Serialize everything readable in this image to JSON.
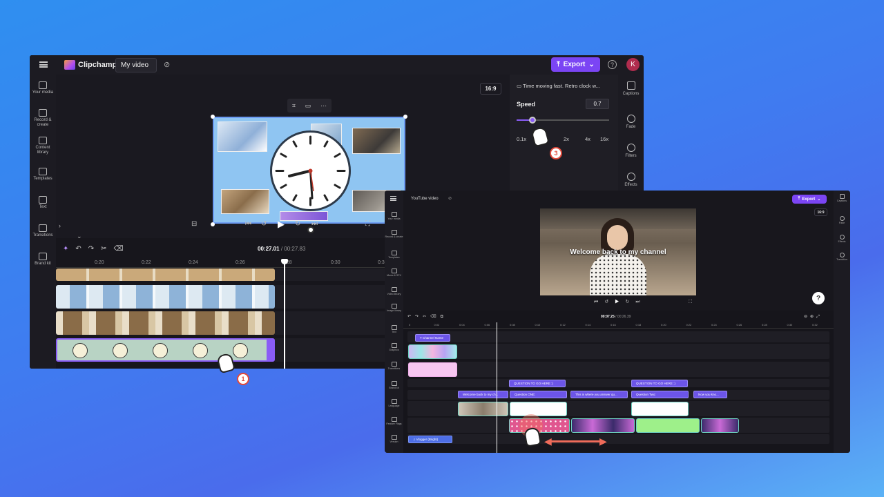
{
  "window1": {
    "app_name": "Clipchamp",
    "project_title": "My video",
    "export_label": "Export",
    "avatar_initial": "K",
    "sidebar": [
      {
        "label": "Your media",
        "icon": "folder-icon"
      },
      {
        "label": "Record & create",
        "icon": "camera-icon"
      },
      {
        "label": "Content library",
        "icon": "library-icon"
      },
      {
        "label": "Templates",
        "icon": "templates-icon"
      },
      {
        "label": "Text",
        "icon": "text-icon"
      },
      {
        "label": "Transitions",
        "icon": "transitions-icon"
      },
      {
        "label": "Brand kit",
        "icon": "brand-kit-icon"
      }
    ],
    "aspect_ratio": "16:9",
    "properties": {
      "clip_title": "Time moving fast. Retro clock w...",
      "speed_label": "Speed",
      "speed_value": "0.7",
      "speed_slider_fraction": 0.17,
      "ticks": [
        "0.1x",
        "1x",
        "2x",
        "4x",
        "16x"
      ]
    },
    "right_rail": [
      {
        "label": "Captions",
        "icon": "captions-icon"
      },
      {
        "label": "Fade",
        "icon": "fade-icon"
      },
      {
        "label": "Filters",
        "icon": "filters-icon"
      },
      {
        "label": "Effects",
        "icon": "effects-icon"
      }
    ],
    "timecode_current": "00:27.01",
    "timecode_total": "/ 00:27.83",
    "ruler": [
      "0:20",
      "0:22",
      "0:24",
      "0:26",
      "0:28",
      "0:30",
      "0:3"
    ],
    "step_badge_1": "1",
    "step_badge_3": "3"
  },
  "window2": {
    "project_title": "YouTube video",
    "export_label": "Export",
    "aspect_ratio": "16:9",
    "video_caption": "Welcome back to my channel",
    "help_label": "?",
    "sidebar": [
      {
        "label": "Your media"
      },
      {
        "label": "Record & create"
      },
      {
        "label": "Templates"
      },
      {
        "label": "Music & SFX"
      },
      {
        "label": "Video library"
      },
      {
        "label": "Image library"
      },
      {
        "label": "Text"
      },
      {
        "label": "Graphics"
      },
      {
        "label": "Transitions"
      },
      {
        "label": "Brand kit"
      },
      {
        "label": "Language"
      },
      {
        "label": "Feature Flags"
      },
      {
        "label": "Version"
      }
    ],
    "right_rail": [
      {
        "label": "Captions"
      },
      {
        "label": "Fade"
      },
      {
        "label": "Effects"
      },
      {
        "label": "Transition"
      }
    ],
    "timecode_current": "00:07.25",
    "timecode_total": "/ 00:26.39",
    "ruler": [
      "0",
      "0:02",
      "0:04",
      "0:06",
      "0:08",
      "0:10",
      "0:12",
      "0:14",
      "0:16",
      "0:18",
      "0:20",
      "0:22",
      "0:24",
      "0:26",
      "0:28",
      "0:30",
      "0:32"
    ],
    "channel_name_label": "Channel Name",
    "questions": [
      "QUESTION TO GO HERE :)",
      "QUESTION TO GO HERE :)"
    ],
    "captions": [
      "Welcome back to my ch...",
      "Question ONE:",
      "This is where you answer qu...",
      "Question Two:",
      "Now you kno..."
    ],
    "audio_label": "Vlogger (Bright)"
  }
}
